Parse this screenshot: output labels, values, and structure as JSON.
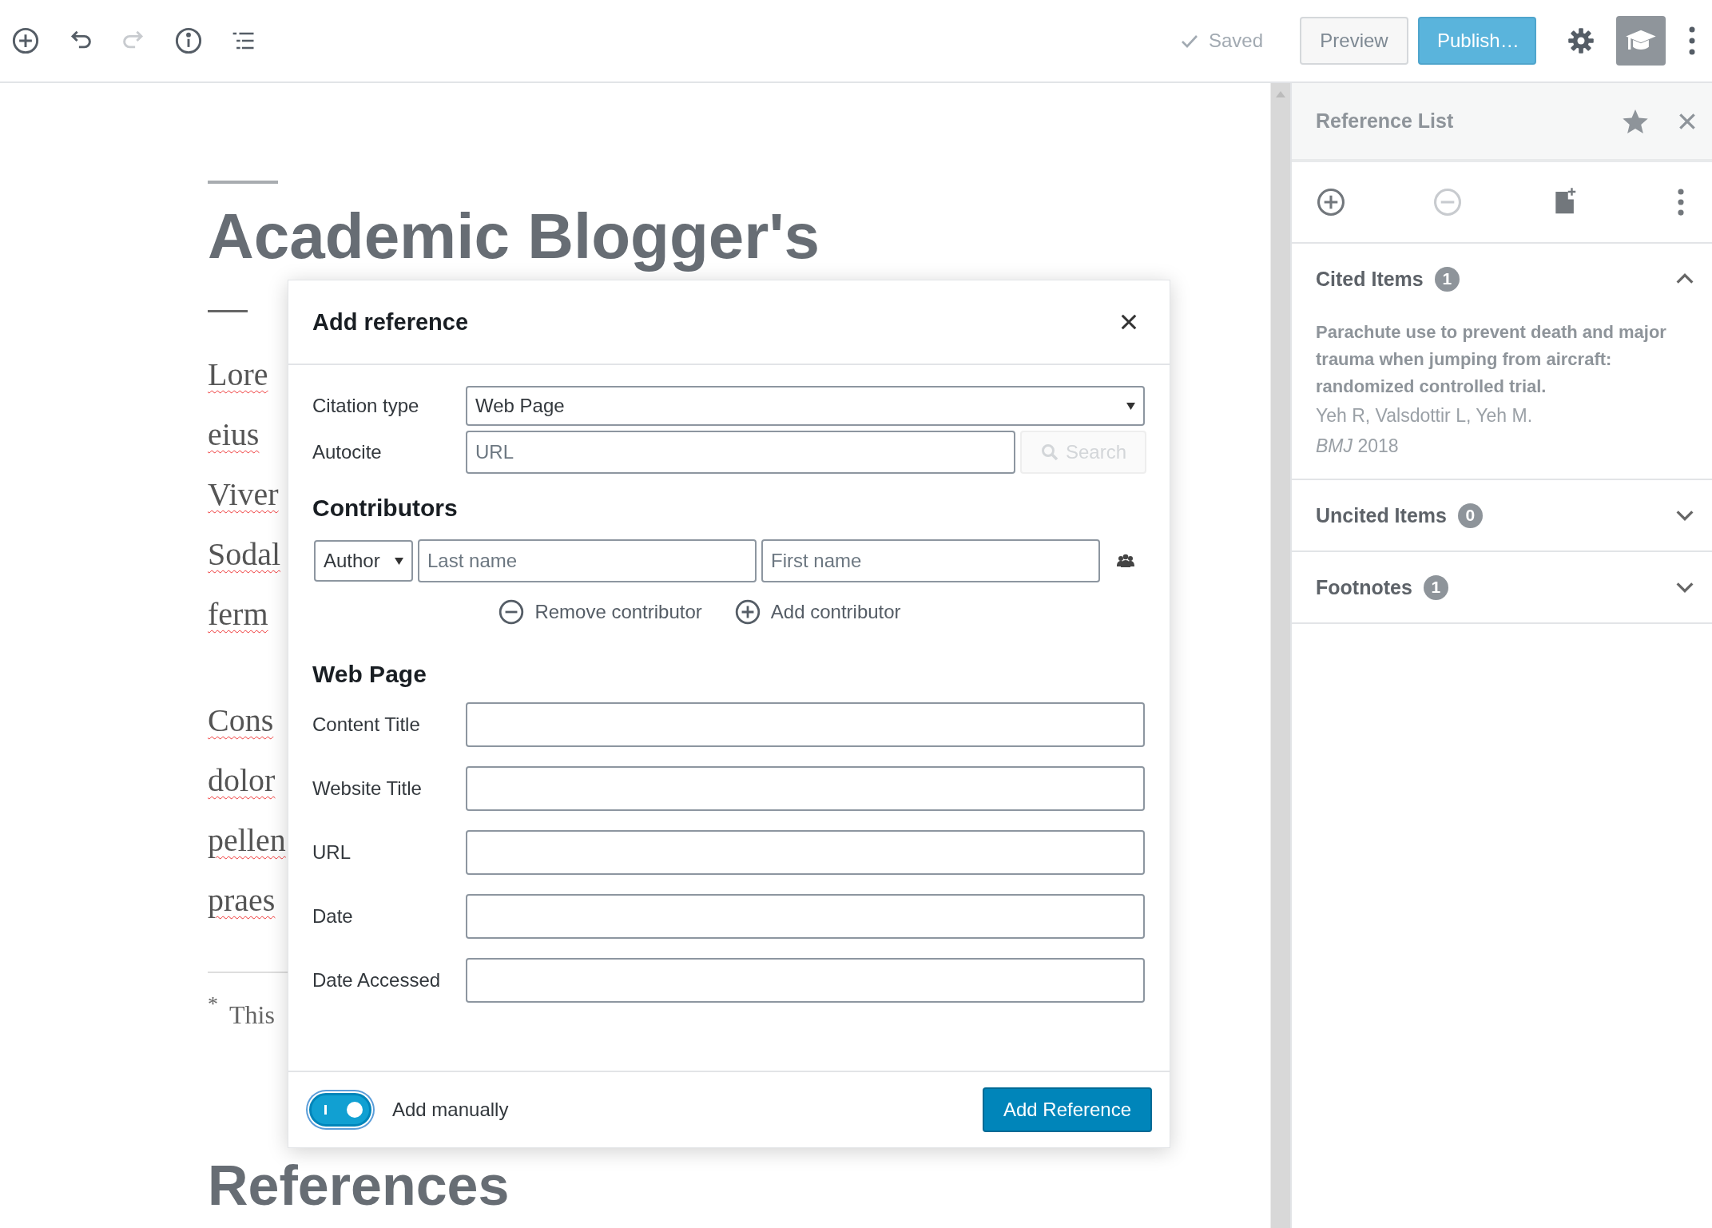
{
  "toolbar": {
    "tools": [
      {
        "kind": "add",
        "disabled": false
      },
      {
        "kind": "undo",
        "disabled": false
      },
      {
        "kind": "redo",
        "disabled": true
      },
      {
        "kind": "info",
        "disabled": false
      },
      {
        "kind": "outline",
        "disabled": false
      }
    ],
    "status": "Saved",
    "buttons": [
      {
        "label": "Preview",
        "kind": "secondary"
      },
      {
        "label": "Publish…",
        "kind": "primary"
      }
    ]
  },
  "editor": {
    "title": "Academic Blogger's",
    "paragraphs": [
      [
        "Lore",
        "eius",
        "Viver",
        "Sodal",
        "ferm"
      ],
      [
        "Cons",
        "dolor",
        "pellen",
        "praes"
      ]
    ],
    "footnote": {
      "mark": "*",
      "text": "This"
    },
    "references_heading": "References"
  },
  "sidebar": {
    "title": "Reference List",
    "tools": [
      {
        "kind": "add",
        "disabled": false
      },
      {
        "kind": "remove",
        "disabled": true
      },
      {
        "kind": "import",
        "disabled": false
      },
      {
        "kind": "more",
        "disabled": false
      }
    ],
    "sections": [
      {
        "title": "Cited Items",
        "count": "1",
        "expanded": true,
        "items": [
          {
            "title": "Parachute use to prevent death and major trauma when jumping from aircraft: randomized controlled trial.",
            "authors": "Yeh R, Valsdottir L, Yeh M.",
            "source": "*BMJ* 2018"
          }
        ]
      },
      {
        "title": "Uncited Items",
        "count": "0",
        "expanded": false
      },
      {
        "title": "Footnotes",
        "count": "1",
        "expanded": false
      }
    ]
  },
  "dialog": {
    "title": "Add reference",
    "citation_type": {
      "label": "Citation type",
      "value": "Web Page"
    },
    "autocite": {
      "label": "Autocite",
      "placeholder": "URL",
      "button": "Search",
      "button_disabled": true
    },
    "contributors_heading": "Contributors",
    "contributors": [
      {
        "role": "Author",
        "last_placeholder": "Last name",
        "first_placeholder": "First name"
      }
    ],
    "remove_contributor": "Remove contributor",
    "add_contributor": "Add contributor",
    "section_heading": "Web Page",
    "fields": [
      {
        "label": "Content Title"
      },
      {
        "label": "Website Title"
      },
      {
        "label": "URL"
      },
      {
        "label": "Date"
      },
      {
        "label": "Date Accessed"
      }
    ],
    "add_manually": {
      "label": "Add manually",
      "on": true
    },
    "submit": "Add Reference"
  }
}
